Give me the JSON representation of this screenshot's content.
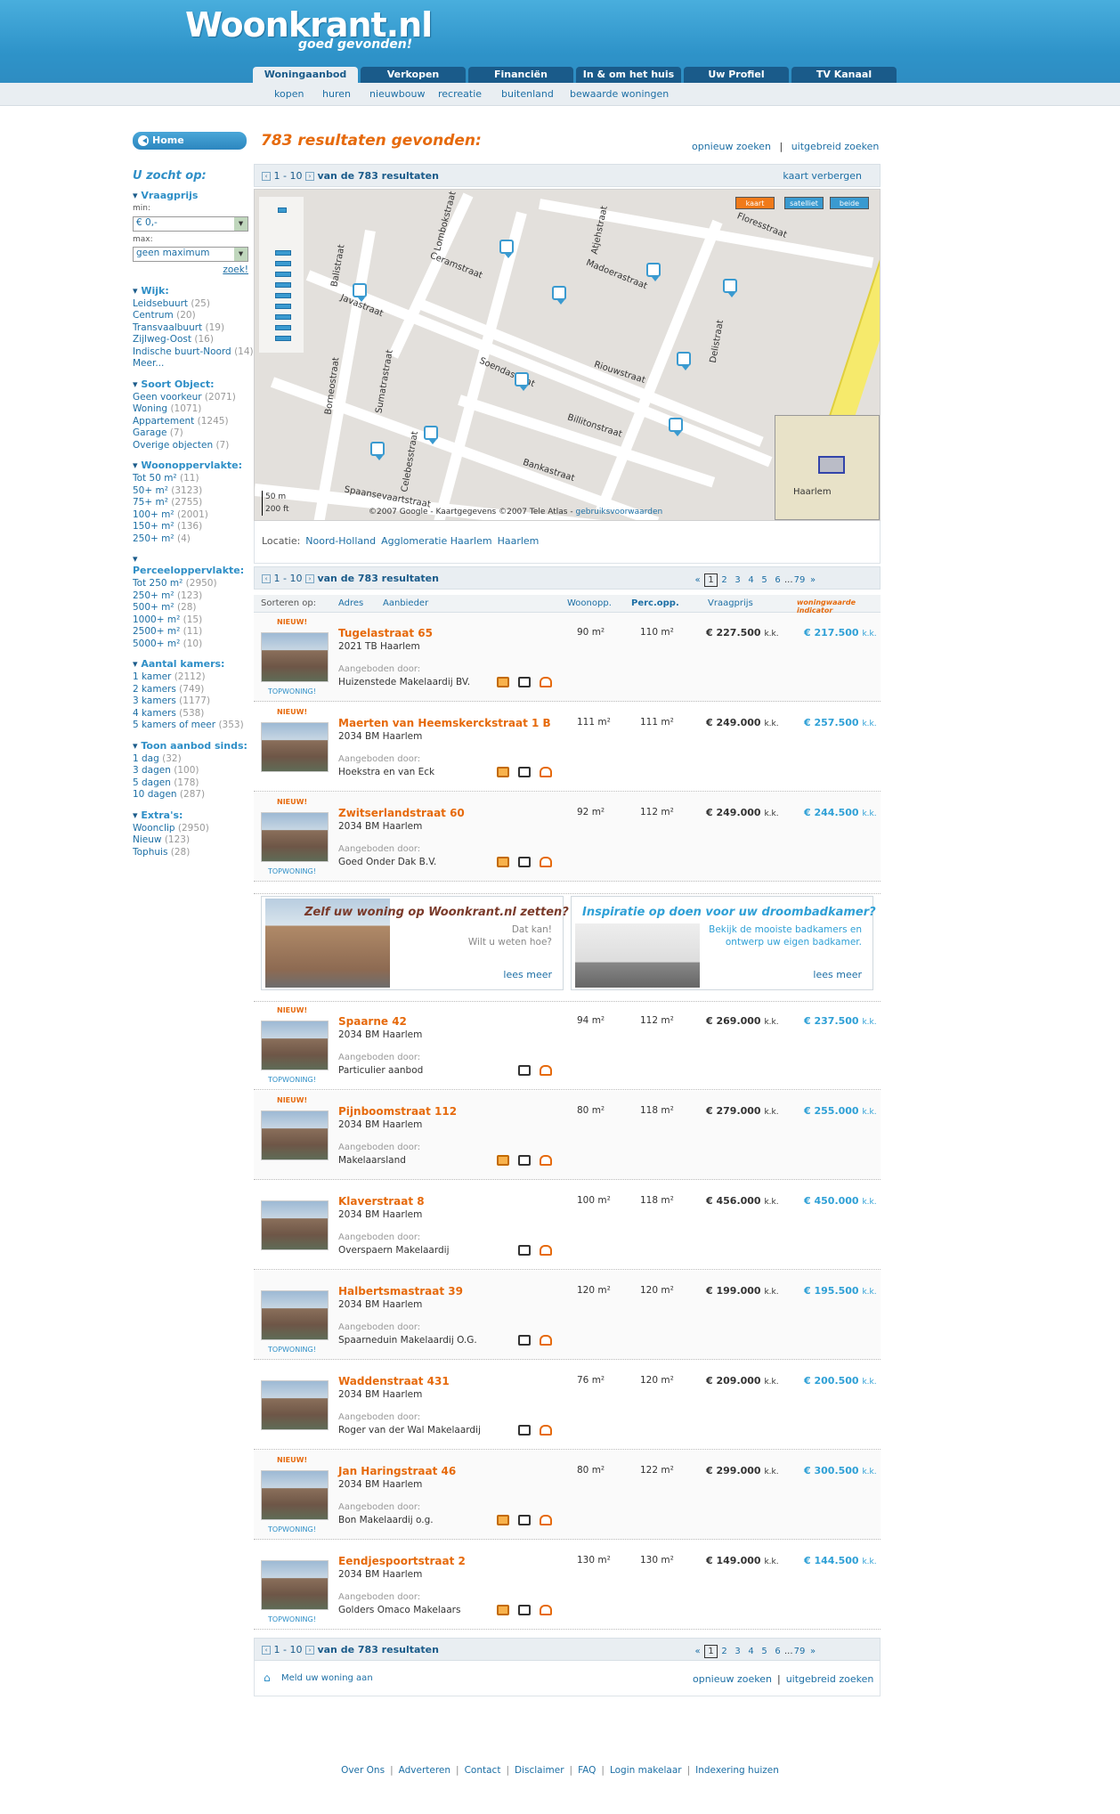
{
  "header": {
    "logo": "Woonkrant.nl",
    "slogan": "goed gevonden!"
  },
  "tabs": [
    "Woningaanbod",
    "Verkopen",
    "Financiën",
    "In & om het huis",
    "Uw Profiel",
    "TV Kanaal"
  ],
  "subnav": [
    "kopen",
    "huren",
    "nieuwbouw",
    "recreatie",
    "buitenland",
    "bewaarde woningen"
  ],
  "home": "Home",
  "results_title": "783 resultaten gevonden:",
  "toplinks": {
    "again": "opnieuw zoeken",
    "sep": "|",
    "advanced": "uitgebreid zoeken"
  },
  "resbar": {
    "range": "1 - 10",
    "label": "van de 783 resultaten",
    "hide_map": "kaart verbergen"
  },
  "map": {
    "buttons": [
      "kaart",
      "satelliet",
      "beide"
    ],
    "copyright": "©2007 Google - Kaartgegevens ©2007 Tele Atlas -",
    "terms": "gebruiksvoorwaarden",
    "scale_m": "50 m",
    "scale_ft": "200 ft",
    "inset": "Haarlem",
    "streets": [
      "Floresstraat",
      "Lombokstraat",
      "Madoerastraat",
      "Atjehstraat",
      "Ceramstraat",
      "Balistraat",
      "Soendastraat",
      "Riouwstraat",
      "Billitonstraat",
      "Bankastraat",
      "Delistraat",
      "Sumatrastraat",
      "Celebesstraat",
      "Borneostraat",
      "Spaansevaartstraat",
      "Javastraat"
    ]
  },
  "locatie": {
    "label": "Locatie:",
    "links": [
      "Noord-Holland",
      "Agglomeratie Haarlem",
      "Haarlem"
    ]
  },
  "sidebar": {
    "title": "U zocht op:",
    "vraagprijs": {
      "label": "Vraagprijs",
      "min": "min:",
      "min_val": "€ 0,-",
      "max": "max:",
      "max_val": "geen maximum",
      "go": "zoek!"
    },
    "groups": [
      {
        "title": "Wijk:",
        "items": [
          [
            "Leidsebuurt",
            "(25)"
          ],
          [
            "Centrum",
            "(20)"
          ],
          [
            "Transvaalbuurt",
            "(19)"
          ],
          [
            "Zijlweg-Oost",
            "(16)"
          ],
          [
            "Indische buurt-Noord",
            "(14)"
          ],
          [
            "Meer...",
            ""
          ]
        ]
      },
      {
        "title": "Soort Object:",
        "items": [
          [
            "Geen voorkeur",
            "(2071)"
          ],
          [
            "Woning",
            "(1071)"
          ],
          [
            "Appartement",
            "(1245)"
          ],
          [
            "Garage",
            "(7)"
          ],
          [
            "Overige objecten",
            "(7)"
          ]
        ]
      },
      {
        "title": "Woonoppervlakte:",
        "items": [
          [
            "Tot 50 m²",
            "(11)"
          ],
          [
            "50+ m²",
            "(3123)"
          ],
          [
            "75+ m²",
            "(2755)"
          ],
          [
            "100+ m²",
            "(2001)"
          ],
          [
            "150+ m²",
            "(136)"
          ],
          [
            "250+ m²",
            "(4)"
          ]
        ]
      },
      {
        "title": "Perceeloppervlakte:",
        "items": [
          [
            "Tot 250 m²",
            "(2950)"
          ],
          [
            "250+ m²",
            "(123)"
          ],
          [
            "500+ m²",
            "(28)"
          ],
          [
            "1000+ m²",
            "(15)"
          ],
          [
            "2500+ m²",
            "(11)"
          ],
          [
            "5000+ m²",
            "(10)"
          ]
        ]
      },
      {
        "title": "Aantal kamers:",
        "items": [
          [
            "1 kamer",
            "(2112)"
          ],
          [
            "2 kamers",
            "(749)"
          ],
          [
            "3 kamers",
            "(1177)"
          ],
          [
            "4 kamers",
            "(538)"
          ],
          [
            "5 kamers of meer",
            "(353)"
          ]
        ]
      },
      {
        "title": "Toon aanbod sinds:",
        "items": [
          [
            "1 dag",
            "(32)"
          ],
          [
            "3 dagen",
            "(100)"
          ],
          [
            "5 dagen",
            "(178)"
          ],
          [
            "10 dagen",
            "(287)"
          ]
        ]
      },
      {
        "title": "Extra's:",
        "items": [
          [
            "Woonclip",
            "(2950)"
          ],
          [
            "Nieuw",
            "(123)"
          ],
          [
            "Tophuis",
            "(28)"
          ]
        ]
      }
    ]
  },
  "sort": {
    "label": "Sorteren op:",
    "cols": [
      "Adres",
      "Aanbieder",
      "Woonopp.",
      "Perc.opp.",
      "Vraagprijs"
    ],
    "wwi": "woningwaarde indicator"
  },
  "pager": {
    "prev": "«",
    "pages": [
      "1",
      "2",
      "3",
      "4",
      "5",
      "6"
    ],
    "dots": "...",
    "last": "79",
    "next": "»"
  },
  "labels": {
    "nieuw": "NIEUW!",
    "top": "TOPWONING!",
    "aangeboden": "Aangeboden door:",
    "kk": "k.k."
  },
  "listings": [
    {
      "addr": "Tugelastraat 65",
      "pc": "2021 TB Haarlem",
      "agent": "Huizenstede Makelaardij BV.",
      "woon": "90 m²",
      "perc": "110 m²",
      "price": "€ 227.500",
      "wwi": "€ 217.500",
      "nieuw": true,
      "top": true,
      "video": true
    },
    {
      "addr": "Maerten van Heemskerckstraat 1 B",
      "pc": "2034 BM Haarlem",
      "agent": "Hoekstra en van Eck",
      "woon": "111 m²",
      "perc": "111 m²",
      "price": "€ 249.000",
      "wwi": "€ 257.500",
      "nieuw": true,
      "top": false,
      "video": true
    },
    {
      "addr": "Zwitserlandstraat 60",
      "pc": "2034 BM Haarlem",
      "agent": "Goed Onder Dak B.V.",
      "woon": "92 m²",
      "perc": "112 m²",
      "price": "€ 249.000",
      "wwi": "€ 244.500",
      "nieuw": true,
      "top": true,
      "video": true
    },
    {
      "addr": "Spaarne 42",
      "pc": "2034 BM Haarlem",
      "agent": "Particulier aanbod",
      "woon": "94 m²",
      "perc": "112 m²",
      "price": "€ 269.000",
      "wwi": "€ 237.500",
      "nieuw": true,
      "top": true,
      "video": false
    },
    {
      "addr": "Pijnboomstraat 112",
      "pc": "2034 BM Haarlem",
      "agent": "Makelaarsland",
      "woon": "80 m²",
      "perc": "118 m²",
      "price": "€ 279.000",
      "wwi": "€ 255.000",
      "nieuw": true,
      "top": false,
      "video": true
    },
    {
      "addr": "Klaverstraat 8",
      "pc": "2034 BM Haarlem",
      "agent": "Overspaern Makelaardij",
      "woon": "100 m²",
      "perc": "118 m²",
      "price": "€ 456.000",
      "wwi": "€ 450.000",
      "nieuw": false,
      "top": false,
      "video": false
    },
    {
      "addr": "Halbertsmastraat 39",
      "pc": "2034 BM Haarlem",
      "agent": "Spaarneduin Makelaardij O.G.",
      "woon": "120 m²",
      "perc": "120 m²",
      "price": "€ 199.000",
      "wwi": "€ 195.500",
      "nieuw": false,
      "top": true,
      "video": false
    },
    {
      "addr": "Waddenstraat 431",
      "pc": "2034 BM Haarlem",
      "agent": "Roger van der Wal Makelaardij",
      "woon": "76 m²",
      "perc": "120 m²",
      "price": "€ 209.000",
      "wwi": "€ 200.500",
      "nieuw": false,
      "top": false,
      "video": false
    },
    {
      "addr": "Jan Haringstraat 46",
      "pc": "2034 BM Haarlem",
      "agent": "Bon Makelaardij o.g.",
      "woon": "80 m²",
      "perc": "122 m²",
      "price": "€ 299.000",
      "wwi": "€ 300.500",
      "nieuw": true,
      "top": true,
      "video": true
    },
    {
      "addr": "Eendjespoortstraat 2",
      "pc": "2034 BM Haarlem",
      "agent": "Golders Omaco Makelaars",
      "woon": "130 m²",
      "perc": "130 m²",
      "price": "€ 149.000",
      "wwi": "€ 144.500",
      "nieuw": false,
      "top": true,
      "video": true
    }
  ],
  "banners": [
    {
      "title": "Zelf uw woning op Woonkrant.nl zetten?",
      "l1": "Dat kan!",
      "l2": "Wilt u weten hoe?",
      "more": "lees meer"
    },
    {
      "title": "Inspiratie op doen voor uw droombadkamer?",
      "l1": "Bekijk de mooiste badkamers en",
      "l2": "ontwerp uw eigen badkamer.",
      "more": "lees meer"
    }
  ],
  "meld": "Meld uw woning aan",
  "footer": [
    "Over Ons",
    "Adverteren",
    "Contact",
    "Disclaimer",
    "FAQ",
    "Login makelaar",
    "Indexering huizen"
  ],
  "colors": {
    "accent": "#2f8fc7",
    "orange": "#e66a0c",
    "header": "#2e93c9"
  }
}
